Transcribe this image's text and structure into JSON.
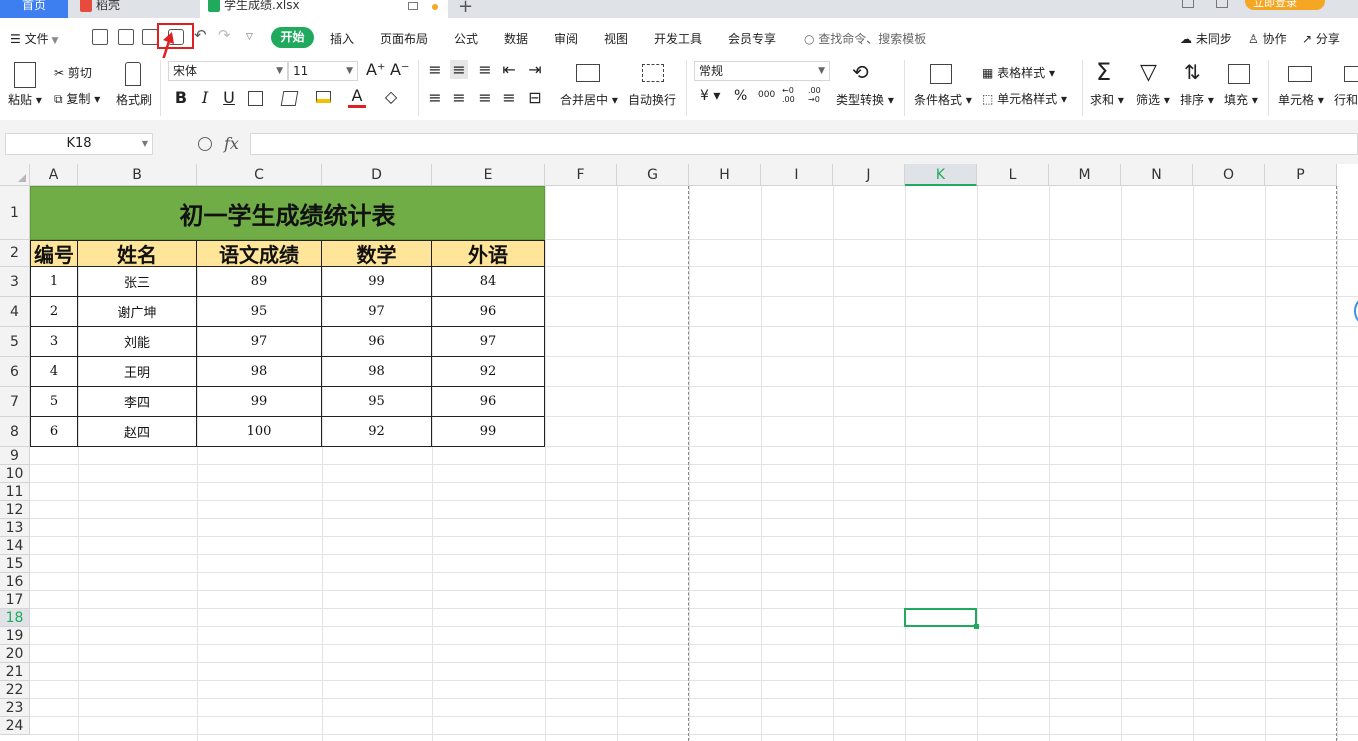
{
  "tabs": {
    "home": "首页",
    "docer": "稻壳",
    "file": "学生成绩.xlsx"
  },
  "login": "立即登录",
  "menu": {
    "file": "文件",
    "start": "开始",
    "items": [
      "插入",
      "页面布局",
      "公式",
      "数据",
      "审阅",
      "视图",
      "开发工具",
      "会员专享"
    ],
    "search_placeholder": "查找命令、搜索模板",
    "sync": "未同步",
    "collab": "协作",
    "share": "分享"
  },
  "ribbon": {
    "paste": "粘贴",
    "cut": "剪切",
    "copy": "复制",
    "format_painter": "格式刷",
    "font_name": "宋体",
    "font_size": "11",
    "merge_center": "合并居中",
    "wrap_text": "自动换行",
    "number_format": "常规",
    "type_convert": "类型转换",
    "cond_format": "条件格式",
    "table_style": "表格样式",
    "cell_style": "单元格样式",
    "sum": "求和",
    "filter": "筛选",
    "sort": "排序",
    "fill": "填充",
    "cell": "单元格",
    "row_col": "行和",
    "bold": "B",
    "italic": "I",
    "underline": "U",
    "font_grow": "A⁺",
    "font_shrink": "A⁻",
    "currency": "¥",
    "percent": "%",
    "thousands": "000",
    "dec_inc": "←0 .00",
    "dec_dec": ".00 →0"
  },
  "formula_bar": {
    "name_box": "K18",
    "fx": "fx",
    "value": ""
  },
  "columns": [
    "A",
    "B",
    "C",
    "D",
    "E",
    "F",
    "G",
    "H",
    "I",
    "J",
    "K",
    "L",
    "M",
    "N",
    "O",
    "P"
  ],
  "rows": [
    "1",
    "2",
    "3",
    "4",
    "5",
    "6",
    "7",
    "8",
    "9",
    "10",
    "11",
    "12",
    "13",
    "14",
    "15",
    "16",
    "17",
    "18",
    "19",
    "20",
    "21",
    "22",
    "23",
    "24"
  ],
  "sheet": {
    "title": "初一学生成绩统计表",
    "headers": [
      "编号",
      "姓名",
      "语文成绩",
      "数学",
      "外语"
    ],
    "records": [
      [
        "1",
        "张三",
        "89",
        "99",
        "84"
      ],
      [
        "2",
        "谢广坤",
        "95",
        "97",
        "96"
      ],
      [
        "3",
        "刘能",
        "97",
        "96",
        "97"
      ],
      [
        "4",
        "王明",
        "98",
        "98",
        "92"
      ],
      [
        "5",
        "李四",
        "99",
        "95",
        "96"
      ],
      [
        "6",
        "赵四",
        "100",
        "92",
        "99"
      ]
    ]
  },
  "colors": {
    "accent": "#1faa5d",
    "title_fill": "#70ad47",
    "header_fill": "#ffe599",
    "highlight": "#e02020",
    "tab_home": "#3d7ff0"
  }
}
